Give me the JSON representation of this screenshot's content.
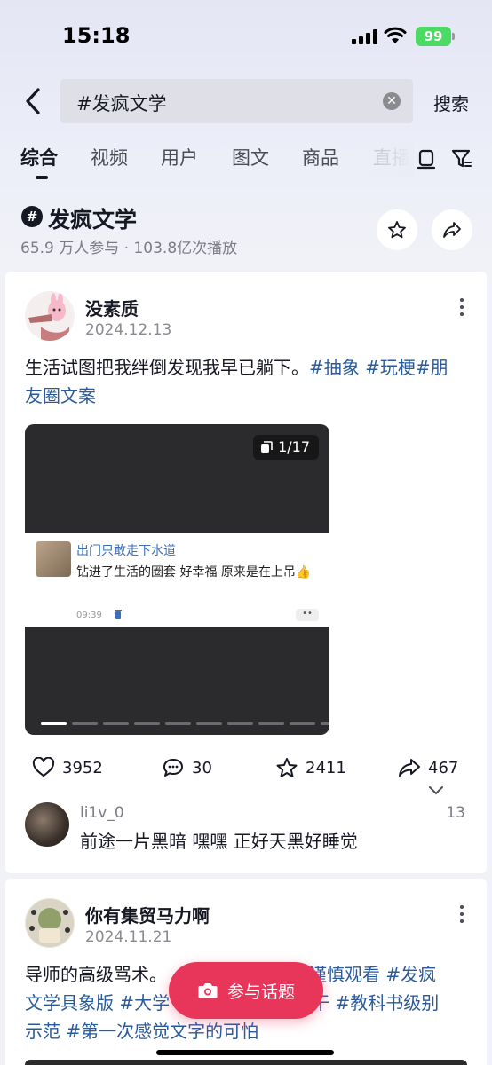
{
  "status_bar": {
    "time": "15:18",
    "battery": "99"
  },
  "search": {
    "query": "#发疯文学",
    "button": "搜索"
  },
  "tabs": [
    {
      "label": "综合",
      "active": true
    },
    {
      "label": "视频"
    },
    {
      "label": "用户"
    },
    {
      "label": "图文"
    },
    {
      "label": "商品"
    },
    {
      "label": "直播"
    }
  ],
  "topic": {
    "title": "发疯文学",
    "meta": "65.9 万人参与 · 103.8亿次播放"
  },
  "posts": [
    {
      "author": "没素质",
      "date": "2024.12.13",
      "text_plain": "生活试图把我绊倒发现我早已躺下。",
      "tags_line1": "#抽象 #玩梗#朋",
      "tags_line2": "友圈文案",
      "media": {
        "counter": "1/17",
        "chat_name": "出门只敢走下水道",
        "chat_message": "钻进了生活的圈套 好幸福 原来是在上吊👍",
        "chat_time": "09:39",
        "slides_total": 17,
        "slide_current": 1
      },
      "likes": "3952",
      "comments": "30",
      "favorites": "2411",
      "shares": "467",
      "top_comment": {
        "user": "li1v_0",
        "text": "前途一片黑暗  嘿嘿  正好天黑好睡觉",
        "count": "13"
      }
    },
    {
      "author": "你有集贸马力啊",
      "date": "2024.11.21",
      "line1_plain": "导师的高级骂术。",
      "line1_tag": "请谨慎观看 #发疯",
      "line2_tag_a": "文学具象版 #大学",
      "line2_tag_b": "都干 #教科书级别",
      "line3_tag": "示范 #第一次感觉文字的可怕"
    }
  ],
  "join_button": "参与话题",
  "colors": {
    "accent": "#e8365a",
    "tag": "#2a5a9a",
    "battery": "#4cd964"
  }
}
